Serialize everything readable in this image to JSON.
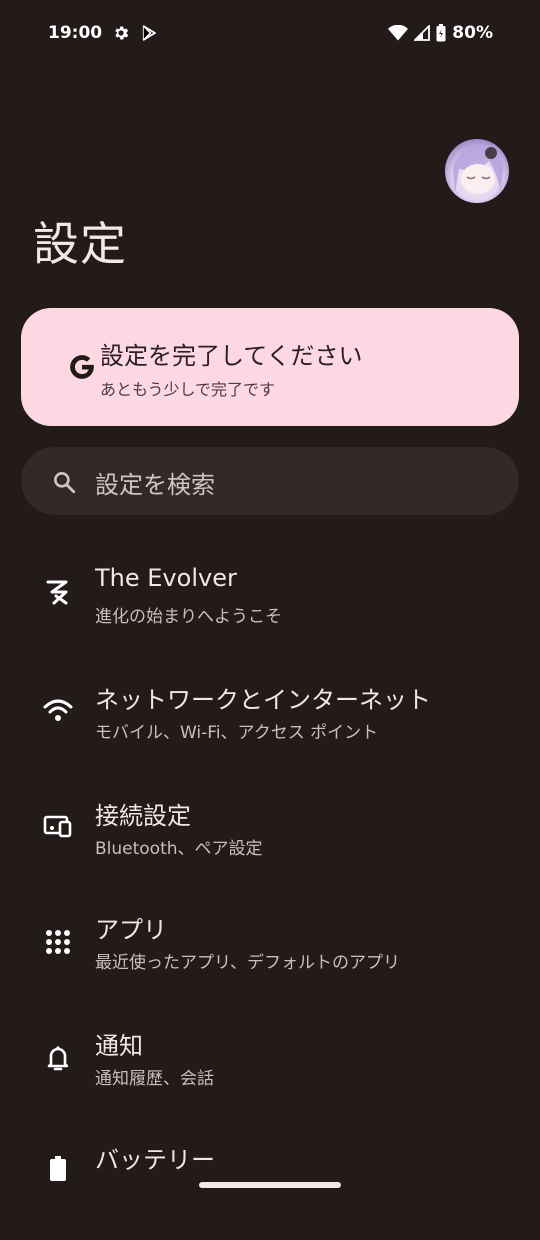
{
  "status_bar": {
    "time": "19:00",
    "battery": "80%",
    "icons": [
      "gear-icon",
      "play-store-icon",
      "wifi-icon",
      "signal-icon",
      "battery-icon"
    ]
  },
  "header": {
    "title": "設定"
  },
  "setup_card": {
    "title": "設定を完了してください",
    "subtitle": "あともう少しで完了です",
    "icon": "google-g-icon"
  },
  "search": {
    "placeholder": "設定を検索"
  },
  "items": [
    {
      "title": "The Evolver",
      "subtitle": "進化の始まりへようこそ",
      "icon": "evolver-icon"
    },
    {
      "title": "ネットワークとインターネット",
      "subtitle": "モバイル、Wi-Fi、アクセス ポイント",
      "icon": "wifi-icon"
    },
    {
      "title": "接続設定",
      "subtitle": "Bluetooth、ペア設定",
      "icon": "devices-icon"
    },
    {
      "title": "アプリ",
      "subtitle": "最近使ったアプリ、デフォルトのアプリ",
      "icon": "apps-grid-icon"
    },
    {
      "title": "通知",
      "subtitle": "通知履歴、会話",
      "icon": "bell-icon"
    },
    {
      "title": "バッテリー",
      "subtitle": "",
      "icon": "battery-icon"
    }
  ],
  "colors": {
    "background": "#231a1a",
    "card": "#fdd7e1",
    "search": "#322929"
  }
}
